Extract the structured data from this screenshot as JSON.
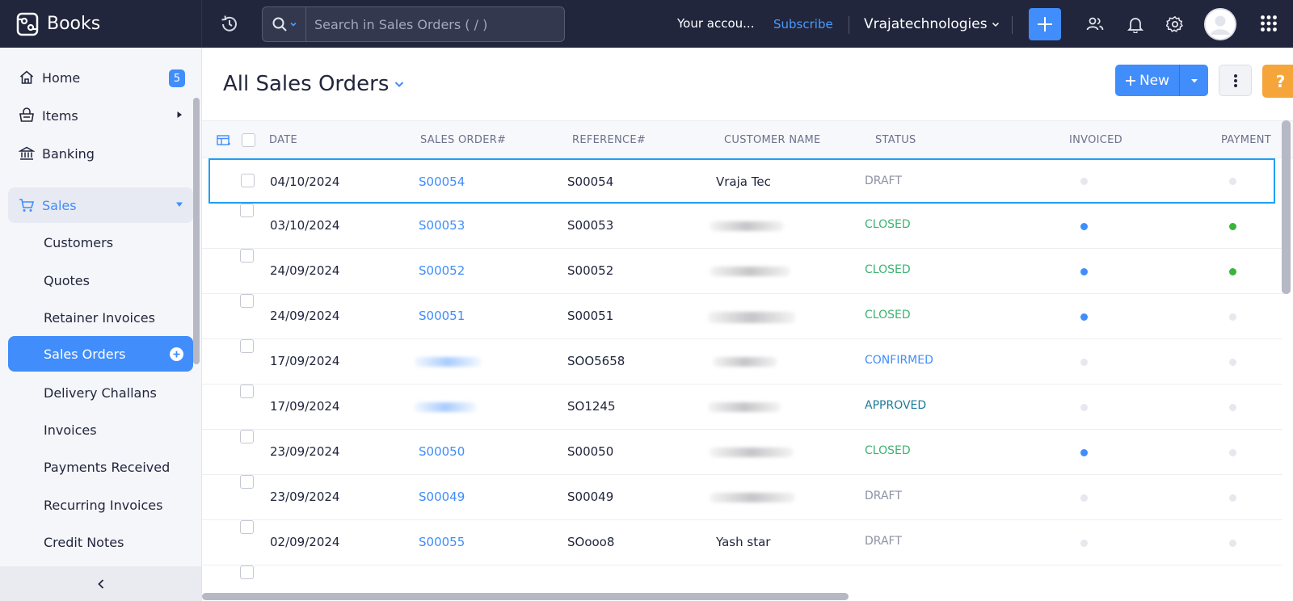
{
  "app": {
    "name": "Books"
  },
  "topbar": {
    "search_placeholder": "Search in Sales Orders ( / )",
    "account_text": "Your accou...",
    "subscribe_label": "Subscribe",
    "org_name": "Vrajatechnologies"
  },
  "sidebar": {
    "home": {
      "label": "Home",
      "badge": "5"
    },
    "items": {
      "label": "Items"
    },
    "banking": {
      "label": "Banking"
    },
    "sales": {
      "label": "Sales"
    },
    "sub_items": [
      "Customers",
      "Quotes",
      "Retainer Invoices",
      "Sales Orders",
      "Delivery Challans",
      "Invoices",
      "Payments Received",
      "Recurring Invoices",
      "Credit Notes"
    ]
  },
  "page": {
    "title": "All Sales Orders",
    "new_label": "New",
    "help_label": "?"
  },
  "table": {
    "headers": {
      "date": "DATE",
      "sales_order": "SALES ORDER#",
      "reference": "REFERENCE#",
      "customer": "CUSTOMER NAME",
      "status": "STATUS",
      "invoiced": "INVOICED",
      "payment": "PAYMENT"
    },
    "rows": [
      {
        "date": "04/10/2024",
        "order": "S00054",
        "reference": "S00054",
        "customer": "Vraja Tec",
        "status": "DRAFT",
        "invoiced": "none",
        "payment": "none"
      },
      {
        "date": "03/10/2024",
        "order": "S00053",
        "reference": "S00053",
        "customer": "",
        "status": "CLOSED",
        "invoiced": "done",
        "payment": "paid"
      },
      {
        "date": "24/09/2024",
        "order": "S00052",
        "reference": "S00052",
        "customer": "",
        "status": "CLOSED",
        "invoiced": "done",
        "payment": "paid"
      },
      {
        "date": "24/09/2024",
        "order": "S00051",
        "reference": "S00051",
        "customer": "",
        "status": "CLOSED",
        "invoiced": "done",
        "payment": "none"
      },
      {
        "date": "17/09/2024",
        "order": "",
        "reference": "SOO5658",
        "customer": "",
        "status": "CONFIRMED",
        "invoiced": "none",
        "payment": "none"
      },
      {
        "date": "17/09/2024",
        "order": "",
        "reference": "SO1245",
        "customer": "",
        "status": "APPROVED",
        "invoiced": "none",
        "payment": "none"
      },
      {
        "date": "23/09/2024",
        "order": "S00050",
        "reference": "S00050",
        "customer": "",
        "status": "CLOSED",
        "invoiced": "done",
        "payment": "none"
      },
      {
        "date": "23/09/2024",
        "order": "S00049",
        "reference": "S00049",
        "customer": "",
        "status": "DRAFT",
        "invoiced": "none",
        "payment": "none"
      },
      {
        "date": "02/09/2024",
        "order": "S00055",
        "reference": "SOooo8",
        "customer": "Yash star",
        "status": "DRAFT",
        "invoiced": "none",
        "payment": "none"
      }
    ]
  },
  "colors": {
    "topbar": "#21263c",
    "accent": "#408dfb",
    "closed": "#3cb371",
    "paid": "#3cb33c",
    "help": "#f6a53a"
  }
}
